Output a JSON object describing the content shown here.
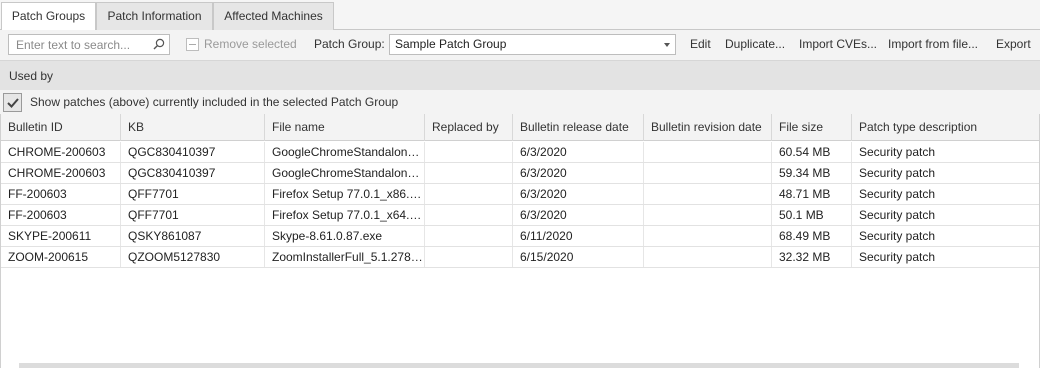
{
  "tabs": [
    {
      "label": "Patch Groups",
      "active": true
    },
    {
      "label": "Patch Information",
      "active": false
    },
    {
      "label": "Affected Machines",
      "active": false
    }
  ],
  "toolbar": {
    "search_placeholder": "Enter text to search...",
    "remove_label": "Remove selected",
    "patch_group_label": "Patch Group:",
    "patch_group_value": "Sample Patch Group",
    "edit_label": "Edit",
    "duplicate_label": "Duplicate...",
    "import_cves_label": "Import CVEs...",
    "import_file_label": "Import from file...",
    "export_label": "Export"
  },
  "used_by": {
    "title": "Used by",
    "show_patches_label": "Show patches (above) currently included in the selected Patch Group",
    "show_patches_checked": true
  },
  "grid": {
    "columns": [
      "Bulletin ID",
      "KB",
      "File name",
      "Replaced by",
      "Bulletin release date",
      "Bulletin revision date",
      "File size",
      "Patch type description"
    ],
    "rows": [
      [
        "CHROME-200603",
        "QGC830410397",
        "GoogleChromeStandalone...",
        "",
        "6/3/2020",
        "",
        "60.54 MB",
        "Security patch"
      ],
      [
        "CHROME-200603",
        "QGC830410397",
        "GoogleChromeStandalone...",
        "",
        "6/3/2020",
        "",
        "59.34 MB",
        "Security patch"
      ],
      [
        "FF-200603",
        "QFF7701",
        "Firefox Setup 77.0.1_x86.exe",
        "",
        "6/3/2020",
        "",
        "48.71 MB",
        "Security patch"
      ],
      [
        "FF-200603",
        "QFF7701",
        "Firefox Setup 77.0.1_x64.exe",
        "",
        "6/3/2020",
        "",
        "50.1 MB",
        "Security patch"
      ],
      [
        "SKYPE-200611",
        "QSKY861087",
        "Skype-8.61.0.87.exe",
        "",
        "6/11/2020",
        "",
        "68.49 MB",
        "Security patch"
      ],
      [
        "ZOOM-200615",
        "QZOOM5127830",
        "ZoomInstallerFull_5.1.2783...",
        "",
        "6/15/2020",
        "",
        "32.32 MB",
        "Security patch"
      ]
    ]
  },
  "icons": {
    "search": "search-icon",
    "checkbox": "checkmark-icon",
    "dropdown": "chevron-down-icon"
  }
}
